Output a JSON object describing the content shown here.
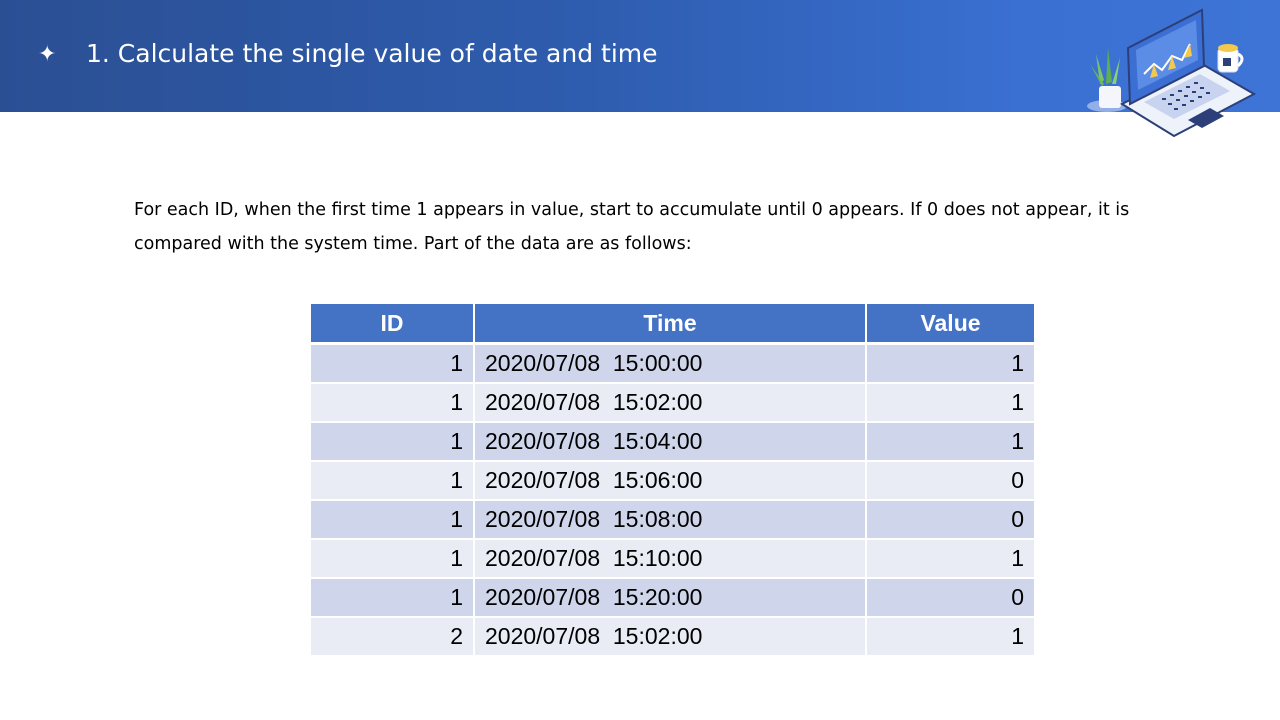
{
  "slide": {
    "bullet_icon": "four-point-star",
    "title": "1. Calculate the single value of date and time",
    "paragraph": "For each ID, when the first time 1 appears in value, start to accumulate until 0 appears. If 0 does not appear, it is compared with the system time. Part of the data are as follows:",
    "illustration": "laptop-with-chart-plant-and-mug",
    "colors": {
      "header_start": "#2b4f93",
      "header_end": "#3d74d6",
      "table_header": "#4472c4",
      "row_odd": "#cfd5ea",
      "row_even": "#e9ebf5"
    }
  },
  "table": {
    "headers": [
      "ID",
      "Time",
      "Value"
    ],
    "rows": [
      [
        "1",
        "2020/07/08  15:00:00",
        "1"
      ],
      [
        "1",
        "2020/07/08  15:02:00",
        "1"
      ],
      [
        "1",
        "2020/07/08  15:04:00",
        "1"
      ],
      [
        "1",
        "2020/07/08  15:06:00",
        "0"
      ],
      [
        "1",
        "2020/07/08  15:08:00",
        "0"
      ],
      [
        "1",
        "2020/07/08  15:10:00",
        "1"
      ],
      [
        "1",
        "2020/07/08  15:20:00",
        "0"
      ],
      [
        "2",
        "2020/07/08  15:02:00",
        "1"
      ]
    ]
  }
}
